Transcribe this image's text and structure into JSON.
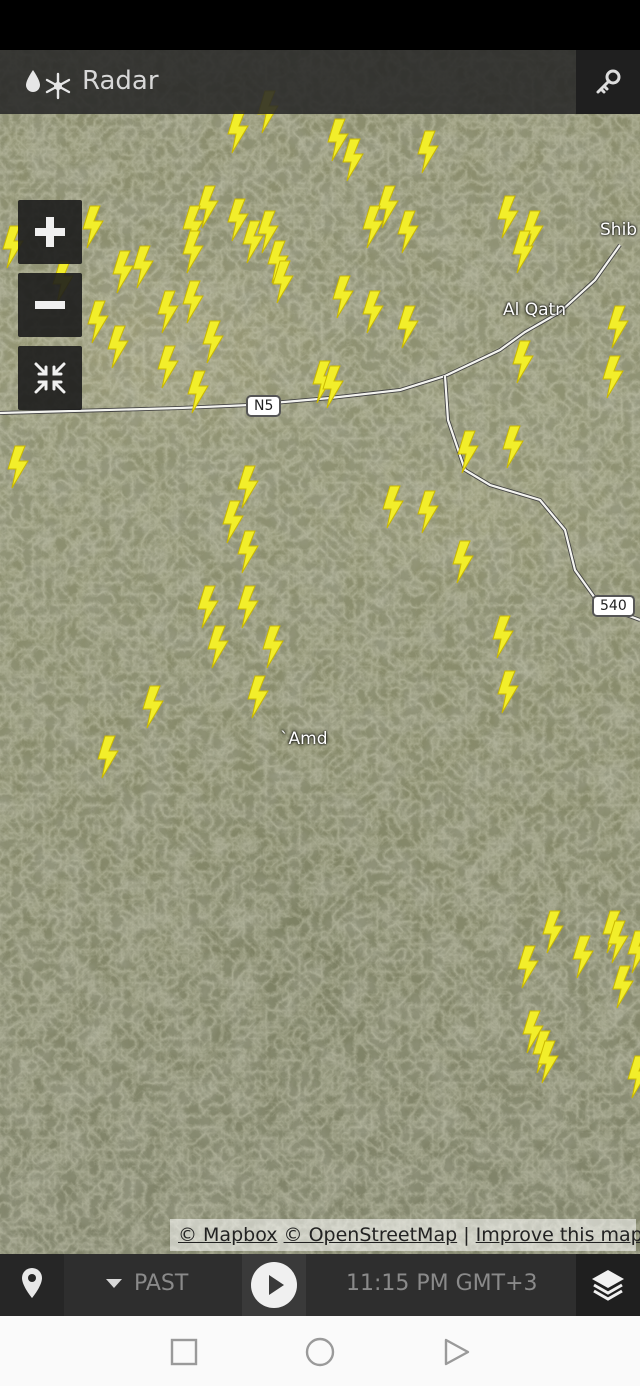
{
  "app": {
    "title": "Radar",
    "logo_icon": "rain-snow-logo-icon",
    "key_icon": "key-icon"
  },
  "map_controls": {
    "zoom_in_icon": "plus-icon",
    "zoom_out_icon": "minus-icon",
    "collapse_icon": "collapse-arrows-icon"
  },
  "map": {
    "places": [
      "Shib",
      "Al Qatn",
      "`Amd"
    ],
    "roads": [
      "N5",
      "540"
    ],
    "lightning_icon": "lightning-bolt-icon",
    "colors": {
      "lightning": "#f2ee2a",
      "terrain": "#8a8c6c",
      "road": "#f4f4f0"
    }
  },
  "attribution": {
    "mapbox": "© Mapbox",
    "osm": "© OpenStreetMap",
    "separator": "|",
    "improve": "Improve this map"
  },
  "timeline": {
    "location_icon": "location-pin-icon",
    "mode": "PAST",
    "play_icon": "play-icon",
    "time": "11:15 PM GMT+3",
    "layers_icon": "layers-icon"
  },
  "navbar": {
    "back_icon": "square-icon",
    "home_icon": "circle-icon",
    "recents_icon": "triangle-icon"
  }
}
